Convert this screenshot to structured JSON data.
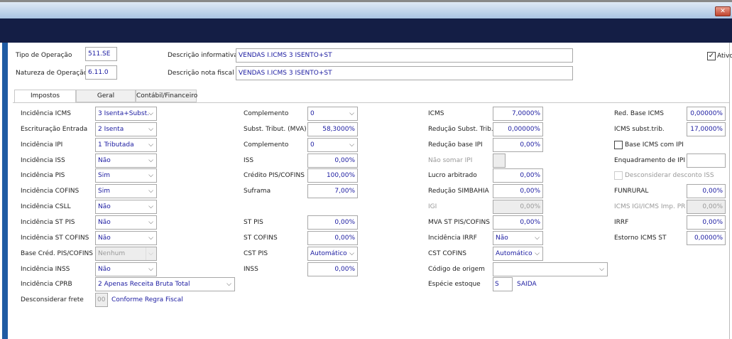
{
  "window": {
    "close_icon": "close-x-icon"
  },
  "header": {
    "tipo_label": "Tipo de Operação",
    "tipo_value": "511.SE",
    "natureza_label": "Natureza de Operação",
    "natureza_value": "6.11.0",
    "desc_info_label": "Descrição informativa",
    "desc_info_value": "VENDAS  I.ICMS 3 ISENTO+ST",
    "desc_nf_label": "Descrição nota fiscal",
    "desc_nf_value": "VENDAS  I.ICMS 3 ISENTO+ST",
    "ativo_label": "Ativo",
    "ativo_checked": true
  },
  "tabs": [
    {
      "label": "Impostos",
      "active": true
    },
    {
      "label": "Geral",
      "active": false
    },
    {
      "label": "Contábil/Financeiro",
      "active": false
    }
  ],
  "columns": [
    [
      {
        "label": "Incidência ICMS",
        "value": "3 Isenta+Subst.",
        "type": "select"
      },
      {
        "label": "Escrituração Entrada",
        "value": "2 Isenta",
        "type": "select"
      },
      {
        "label": "Incidência IPI",
        "value": "1 Tributada",
        "type": "select"
      },
      {
        "label": "Incidência ISS",
        "value": "Não",
        "type": "select"
      },
      {
        "label": "Incidência PIS",
        "value": "Sim",
        "type": "select"
      },
      {
        "label": "Incidência COFINS",
        "value": "Sim",
        "type": "select"
      },
      {
        "label": "Incidência CSLL",
        "value": "Não",
        "type": "select"
      },
      {
        "label": "Incidência ST PIS",
        "value": "Não",
        "type": "select"
      },
      {
        "label": "Incidência ST COFINS",
        "value": "Não",
        "type": "select"
      },
      {
        "label": "Base Créd. PIS/COFINS",
        "value": "Nenhum",
        "type": "select",
        "disabled": true
      },
      {
        "label": "Incidência INSS",
        "value": "Não",
        "type": "select"
      },
      {
        "label": "Incidência CPRB",
        "value": "2 Apenas Receita Bruta Total",
        "type": "select",
        "wide": true
      },
      {
        "label": "Desconsiderar frete",
        "value": "00",
        "type": "code",
        "extra": "Conforme Regra Fiscal"
      }
    ],
    [
      {
        "label": "Complemento",
        "value": "0",
        "type": "select"
      },
      {
        "label": "Subst. Tribut. (MVA)",
        "value": "58,3000%",
        "type": "num"
      },
      {
        "label": "Complemento",
        "value": "0",
        "type": "select"
      },
      {
        "label": "ISS",
        "value": "0,00%",
        "type": "num"
      },
      {
        "label": "Crédito PIS/COFINS",
        "value": "100,00%",
        "type": "num"
      },
      {
        "label": "Suframa",
        "value": "7,00%",
        "type": "num"
      },
      null,
      {
        "label": "ST PIS",
        "value": "0,00%",
        "type": "num"
      },
      {
        "label": "ST COFINS",
        "value": "0,00%",
        "type": "num"
      },
      {
        "label": "CST PIS",
        "value": "Automático",
        "type": "select"
      },
      {
        "label": "INSS",
        "value": "0,00%",
        "type": "num"
      }
    ],
    [
      {
        "label": "ICMS",
        "value": "7,0000%",
        "type": "num"
      },
      {
        "label": "Redução Subst. Trib.",
        "value": "0,00000%",
        "type": "num"
      },
      {
        "label": "Redução base IPI",
        "value": "0,00%",
        "type": "num"
      },
      {
        "label": "Não somar IPI",
        "value": "",
        "type": "smallbox",
        "disabled": true
      },
      {
        "label": "Lucro arbitrado",
        "value": "0,00%",
        "type": "num"
      },
      {
        "label": "Redução SIMBAHIA",
        "value": "0,00%",
        "type": "num"
      },
      {
        "label": "IGI",
        "value": "0,00%",
        "type": "num",
        "disabled": true
      },
      {
        "label": "MVA ST PIS/COFINS",
        "value": "0,00%",
        "type": "num"
      },
      {
        "label": "Incidência IRRF",
        "value": "Não",
        "type": "select"
      },
      {
        "label": "CST COFINS",
        "value": "Automático",
        "type": "select"
      },
      {
        "label": "Código de origem",
        "value": "",
        "type": "select",
        "wide": true
      },
      {
        "label": "Espécie estoque",
        "value": "S",
        "type": "code",
        "extra": "SAIDA"
      }
    ],
    [
      {
        "label": "Red. Base ICMS",
        "value": "0,00000%",
        "type": "num"
      },
      {
        "label": "ICMS subst.trib.",
        "value": "17,0000%",
        "type": "num"
      },
      {
        "label": "Base ICMS com IPI",
        "type": "checkbox",
        "checked": false
      },
      {
        "label": "Enquadramento de IPI",
        "value": "",
        "type": "num"
      },
      {
        "label": "Desconsiderar desconto ISS",
        "type": "checkbox",
        "checked": false,
        "disabled": true
      },
      {
        "label": "FUNRURAL",
        "value": "0,00%",
        "type": "num"
      },
      {
        "label": "ICMS IGI/ICMS Imp. PR",
        "value": "0,00%",
        "type": "num",
        "disabled": true
      },
      {
        "label": "IRRF",
        "value": "0,00%",
        "type": "num"
      },
      {
        "label": "Estorno ICMS ST",
        "value": "0,0000%",
        "type": "num"
      }
    ]
  ]
}
